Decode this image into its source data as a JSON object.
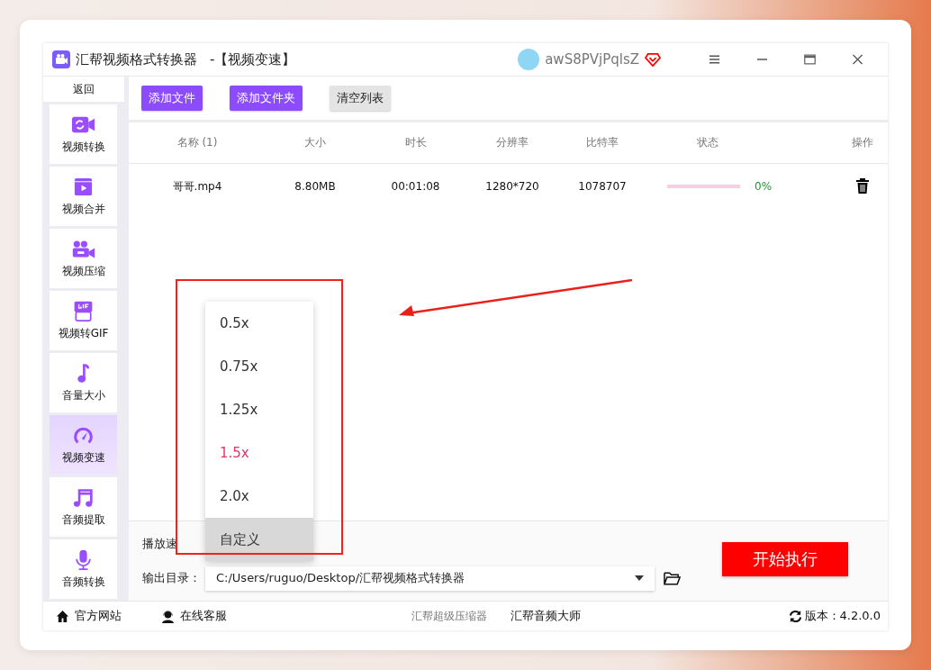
{
  "window": {
    "title": "汇帮视频格式转换器",
    "subtitle": "-【视频变速】",
    "username": "awS8PVjPqlsZ"
  },
  "sidebar": {
    "back": "返回",
    "items": [
      {
        "label": "视频转换",
        "kind": "convert",
        "selected": false
      },
      {
        "label": "视频合并",
        "kind": "merge",
        "selected": false
      },
      {
        "label": "视频压缩",
        "kind": "compress",
        "selected": false
      },
      {
        "label": "视频转GIF",
        "kind": "gif",
        "selected": false
      },
      {
        "label": "音量大小",
        "kind": "note",
        "selected": false
      },
      {
        "label": "视频变速",
        "kind": "gauge",
        "selected": true
      },
      {
        "label": "音频提取",
        "kind": "music",
        "selected": false
      },
      {
        "label": "音频转换",
        "kind": "mic",
        "selected": false
      }
    ]
  },
  "toolbar": [
    {
      "label": "添加文件",
      "kind": "primary"
    },
    {
      "label": "添加文件夹",
      "kind": "primary"
    },
    {
      "label": "清空列表",
      "kind": "plain"
    }
  ],
  "table": {
    "columns": [
      "名称 (1)",
      "大小",
      "时长",
      "分辨率",
      "比特率",
      "状态",
      "操作"
    ],
    "rows": [
      {
        "name": "哥哥.mp4",
        "size": "8.80MB",
        "duration": "00:01:08",
        "resolution": "1280*720",
        "bitrate": "1078707",
        "level": 0,
        "progress": "0%"
      }
    ]
  },
  "speed": {
    "label": "播放速",
    "options": [
      {
        "label": "0.5x",
        "selected": false,
        "hovered": false
      },
      {
        "label": "0.75x",
        "selected": false,
        "hovered": false
      },
      {
        "label": "1.25x",
        "selected": false,
        "hovered": false
      },
      {
        "label": "1.5x",
        "selected": true,
        "hovered": false
      },
      {
        "label": "2.0x",
        "selected": false,
        "hovered": false
      },
      {
        "label": "自定义",
        "selected": false,
        "hovered": true
      }
    ]
  },
  "output": {
    "label": "输出目录：",
    "value": "C:/Users/ruguo/Desktop/汇帮视频格式转换器"
  },
  "start_button": "开始执行",
  "footer": {
    "left": [
      {
        "label": "官方网站",
        "kind": "home"
      },
      {
        "label": "在线客服",
        "kind": "support"
      }
    ],
    "links": [
      {
        "label": "汇帮超级压缩器",
        "muted": true
      },
      {
        "label": "汇帮音频大师",
        "muted": false
      }
    ],
    "version": "版本：4.2.0.0"
  }
}
